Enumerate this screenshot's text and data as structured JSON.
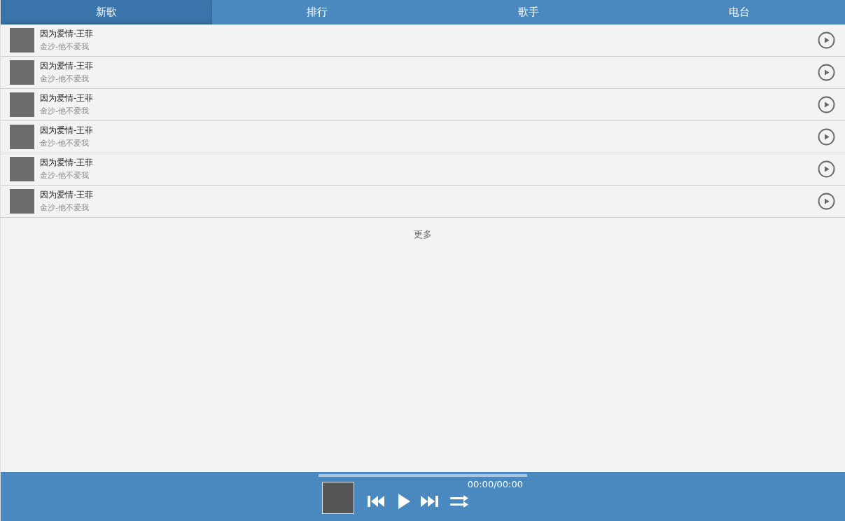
{
  "tabs": [
    {
      "label": "新歌",
      "selected": true
    },
    {
      "label": "排行",
      "selected": false
    },
    {
      "label": "歌手",
      "selected": false
    },
    {
      "label": "电台",
      "selected": false
    }
  ],
  "songs": [
    {
      "title": "因为爱情-王菲",
      "subtitle": "金沙-他不爱我"
    },
    {
      "title": "因为爱情-王菲",
      "subtitle": "金沙-他不爱我"
    },
    {
      "title": "因为爱情-王菲",
      "subtitle": "金沙-他不爱我"
    },
    {
      "title": "因为爱情-王菲",
      "subtitle": "金沙-他不爱我"
    },
    {
      "title": "因为爱情-王菲",
      "subtitle": "金沙-他不爱我"
    },
    {
      "title": "因为爱情-王菲",
      "subtitle": "金沙-他不爱我"
    }
  ],
  "more": "更多",
  "player": {
    "progress": {
      "level": 0
    },
    "time": "00:00/00:00"
  }
}
